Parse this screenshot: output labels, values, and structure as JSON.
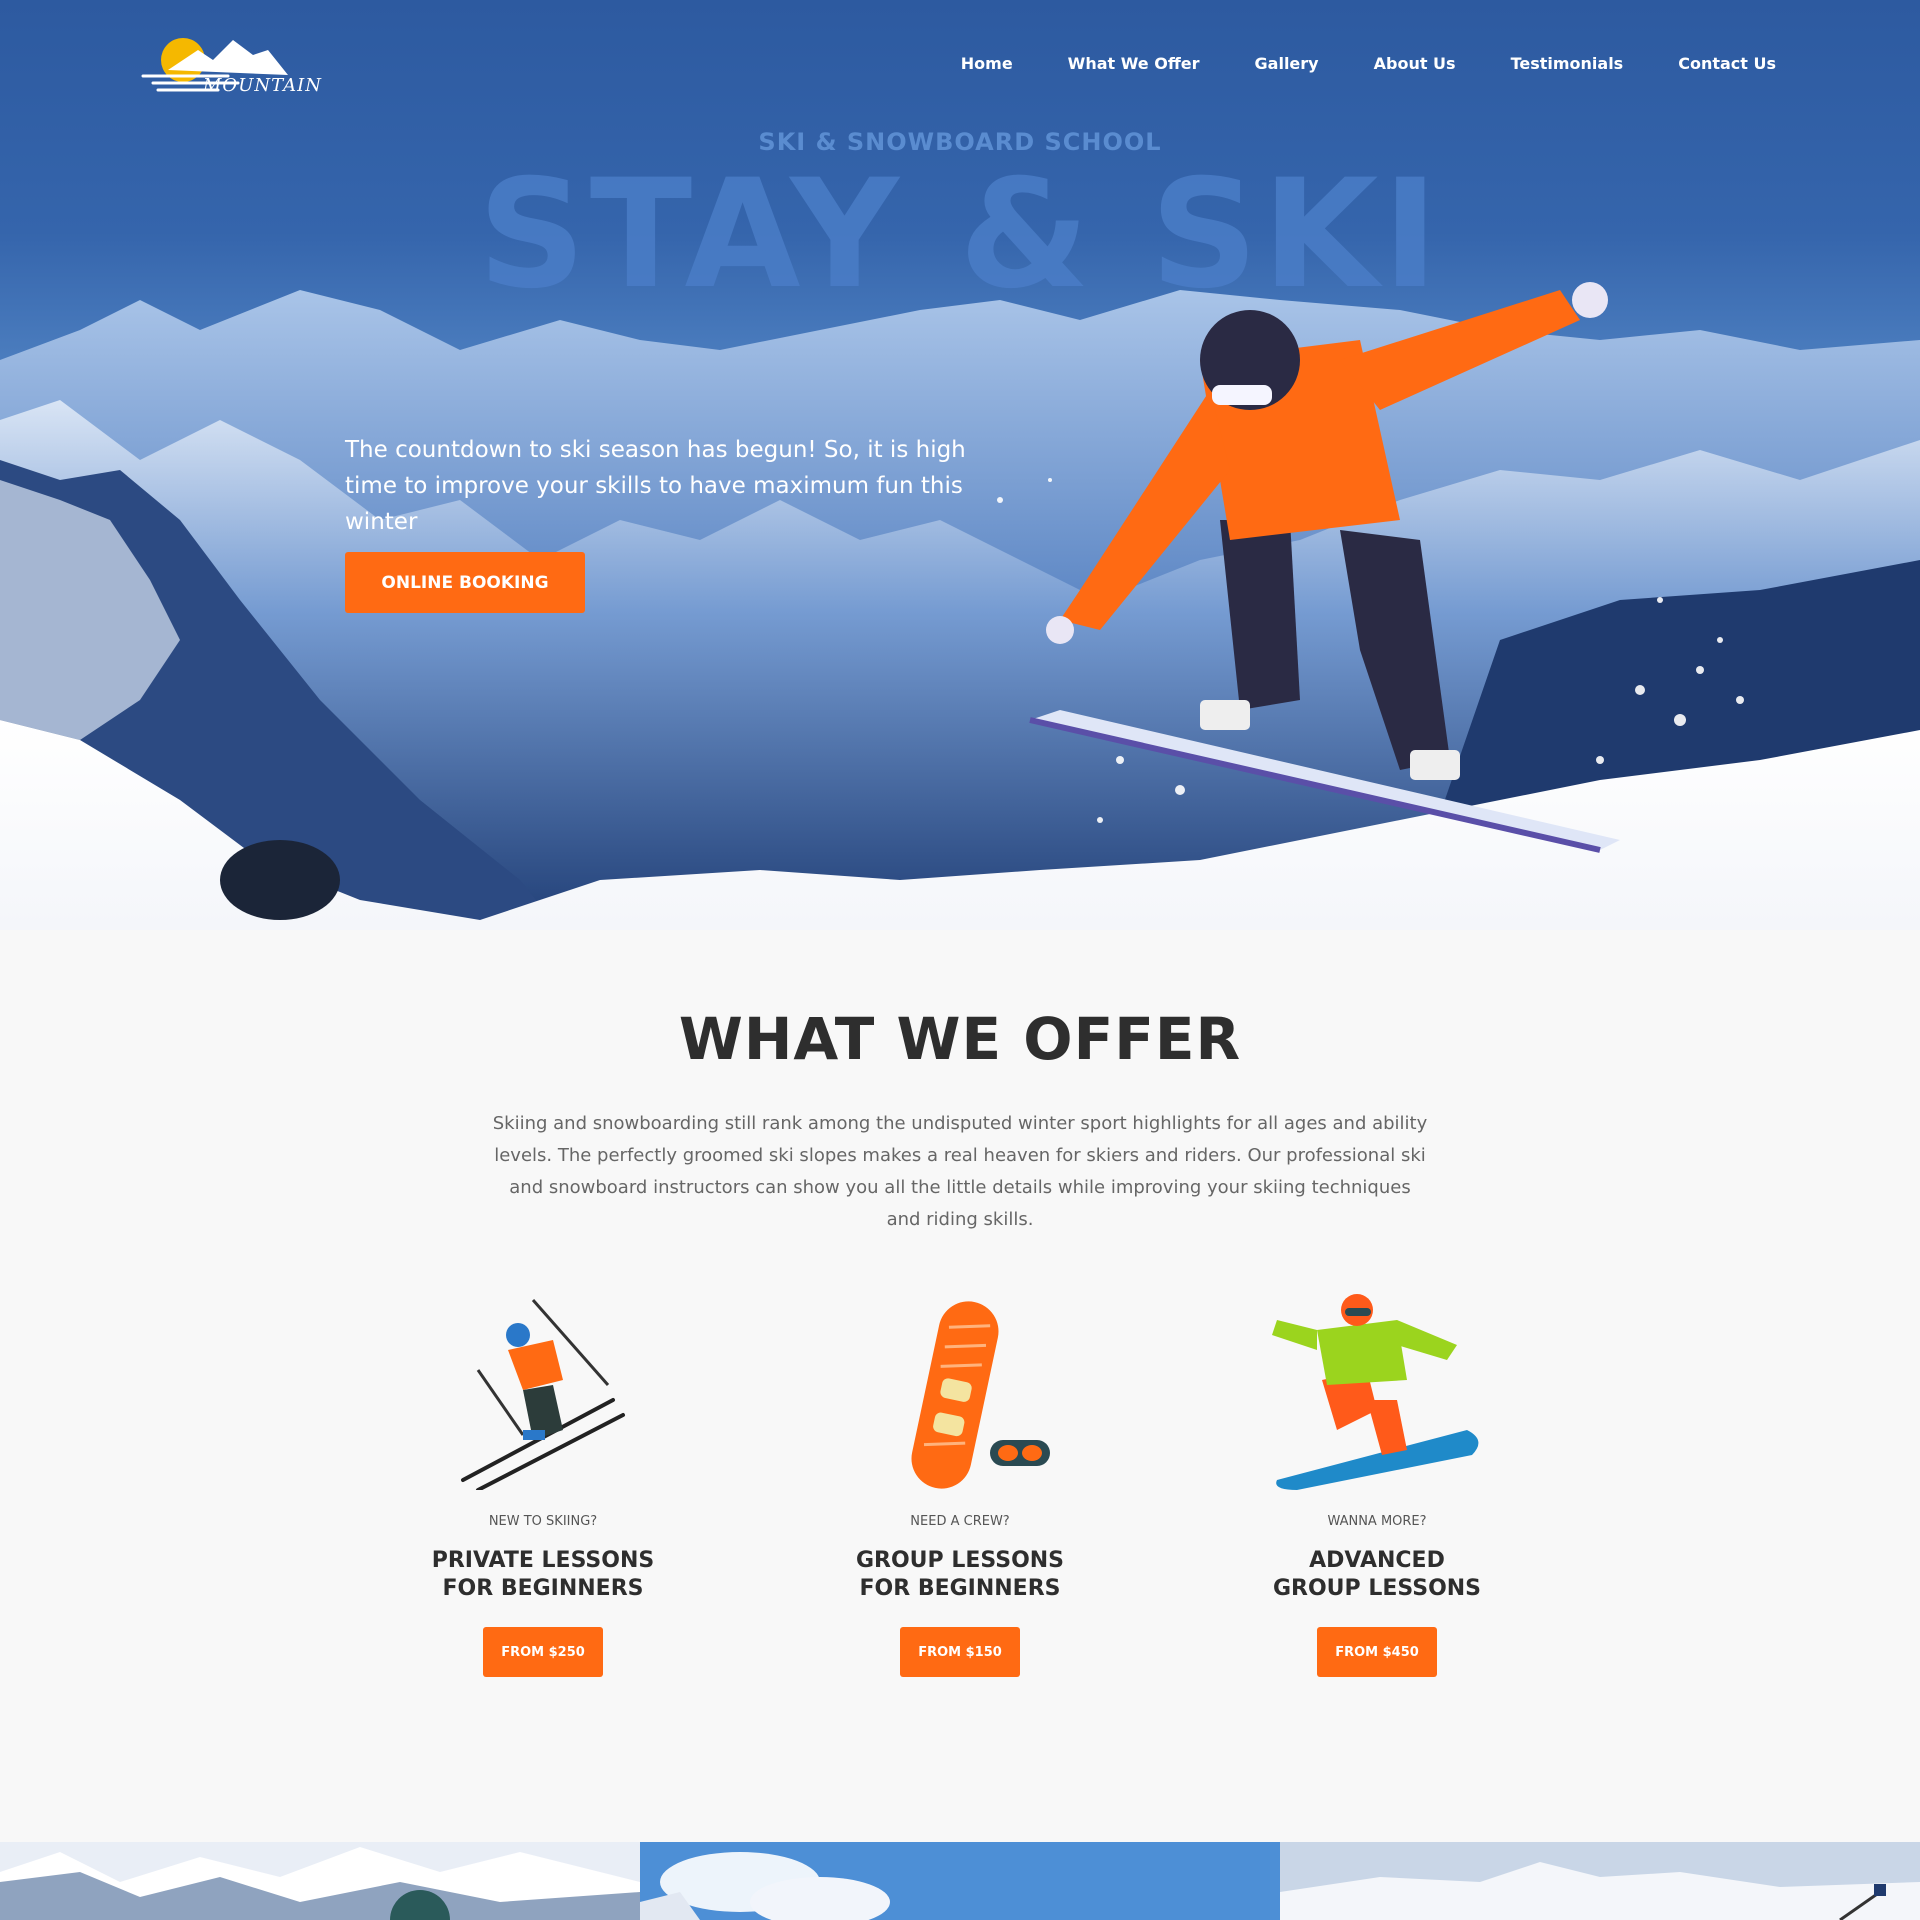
{
  "brand": {
    "name": "MOUNTAIN"
  },
  "nav": {
    "items": [
      {
        "label": "Home"
      },
      {
        "label": "What We Offer"
      },
      {
        "label": "Gallery"
      },
      {
        "label": "About Us"
      },
      {
        "label": "Testimonials"
      },
      {
        "label": "Contact Us"
      }
    ]
  },
  "hero": {
    "subtitle": "SKI & SNOWBOARD SCHOOL",
    "title": "STAY & SKI",
    "text": "The countdown to ski season has begun! So, it is high time to improve your skills to have maximum fun this winter",
    "button_label": "ONLINE BOOKING"
  },
  "offer": {
    "title": "WHAT WE OFFER",
    "description": "Skiing and snowboarding still rank among the undisputed winter sport highlights for all ages and ability levels. The perfectly groomed ski slopes makes a real heaven for skiers and riders. Our professional ski and snowboard instructors can show you all the little details while improving your skiing techniques and riding skills.",
    "cards": [
      {
        "kicker": "NEW TO SKIING?",
        "title": "PRIVATE LESSONS\nFOR BEGINNERS",
        "price": "FROM $250",
        "icon": "skier-icon"
      },
      {
        "kicker": "NEED A CREW?",
        "title": "GROUP LESSONS\nFOR BEGINNERS",
        "price": "FROM $150",
        "icon": "snowboard-goggles-icon"
      },
      {
        "kicker": "WANNA MORE?",
        "title": "ADVANCED\nGROUP LESSONS",
        "price": "FROM $450",
        "icon": "snowboarder-icon"
      }
    ]
  },
  "colors": {
    "accent": "#ff6a13",
    "hero_blue": "#3565ac",
    "heading": "#2e2e2e"
  }
}
